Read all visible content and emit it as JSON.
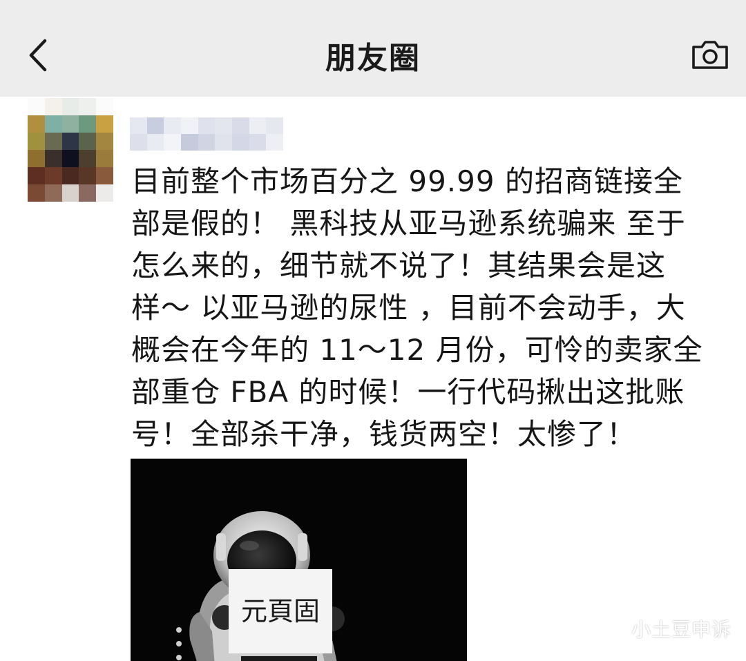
{
  "nav": {
    "title": "朋友圈",
    "back_icon": "chevron-left-icon",
    "camera_icon": "camera-icon",
    "background": "#ededed"
  },
  "post": {
    "text_lines": [
      "目前整个市场百分之 99.99 的招商链接全",
      "部是假的！ 黑科技从亚马逊系统骗来 至于",
      "怎么来的，细节就不说了！其结果会是这",
      "样～ 以亚马逊的尿性 ，目前不会动手，大",
      "概会在今年的 11～12 月份，可怜的卖家全",
      "部重仓 FBA 的时候！一行代码揪出这批账",
      "号！全部杀干净，钱货两空！太惨了！"
    ],
    "image": {
      "sign_text": "元頁固"
    }
  },
  "watermark": {
    "text": "小土豆申诉",
    "icon": "wechat-official-account-icon"
  }
}
